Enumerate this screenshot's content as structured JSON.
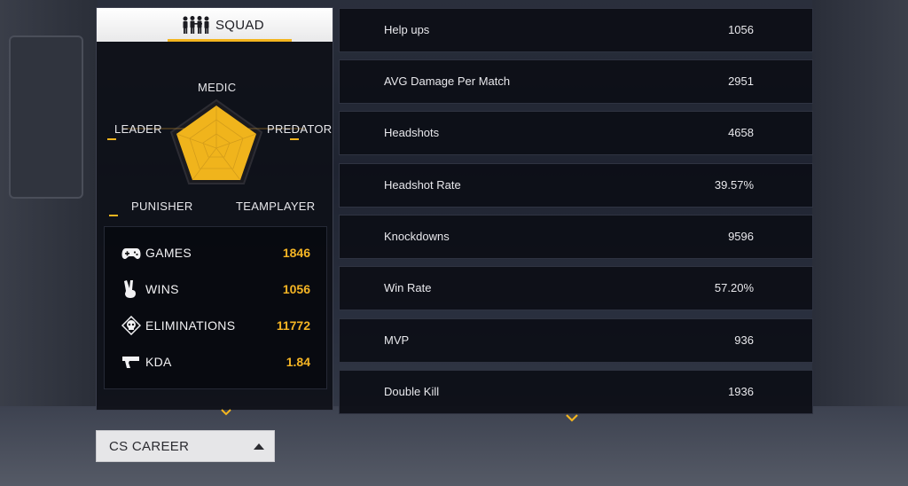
{
  "squad": {
    "title": "SQUAD",
    "radar_labels": {
      "medic": "MEDIC",
      "leader": "LEADER",
      "predator": "PREDATOR",
      "punisher": "PUNISHER",
      "teamplayer": "TEAMPLAYER"
    },
    "summary": [
      {
        "icon": "gamepad-icon",
        "label": "GAMES",
        "value": "1846"
      },
      {
        "icon": "victory-hand-icon",
        "label": "WINS",
        "value": "1056"
      },
      {
        "icon": "skull-icon",
        "label": "ELIMINATIONS",
        "value": "11772"
      },
      {
        "icon": "pistol-icon",
        "label": "KDA",
        "value": "1.84"
      }
    ]
  },
  "stats": [
    {
      "name": "Help ups",
      "value": "1056"
    },
    {
      "name": "AVG Damage Per Match",
      "value": "2951"
    },
    {
      "name": "Headshots",
      "value": "4658"
    },
    {
      "name": "Headshot Rate",
      "value": "39.57%"
    },
    {
      "name": "Knockdowns",
      "value": "9596"
    },
    {
      "name": "Win Rate",
      "value": "57.20%"
    },
    {
      "name": "MVP",
      "value": "936"
    },
    {
      "name": "Double Kill",
      "value": "1936"
    }
  ],
  "career_selector": {
    "label": "CS CAREER"
  },
  "colors": {
    "accent": "#f3b51f",
    "radar_fill": "#f0b41c"
  }
}
